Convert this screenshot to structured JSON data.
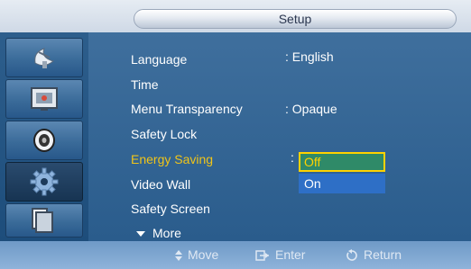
{
  "header": {
    "title": "Setup"
  },
  "sidebar": {
    "items": [
      {
        "icon": "satellite-dish-icon"
      },
      {
        "icon": "picture-icon"
      },
      {
        "icon": "speaker-icon"
      },
      {
        "icon": "gear-icon",
        "active": true
      },
      {
        "icon": "multi-screen-icon"
      }
    ]
  },
  "menu": {
    "items": [
      {
        "label": "Language",
        "value": ": English"
      },
      {
        "label": "Time",
        "value": ""
      },
      {
        "label": "Menu Transparency",
        "value": ": Opaque"
      },
      {
        "label": "Safety Lock",
        "value": ""
      },
      {
        "label": "Energy Saving",
        "value": ":",
        "highlighted": true
      },
      {
        "label": "Video Wall",
        "value": ""
      },
      {
        "label": "Safety Screen",
        "value": ""
      }
    ],
    "more_label": "More"
  },
  "dropdown": {
    "options": [
      "Off",
      "On"
    ],
    "selected": "Off"
  },
  "help_bar": {
    "move": "Move",
    "enter": "Enter",
    "return": "Return"
  },
  "colors": {
    "highlight": "#f0c419",
    "panel": "#2a5c8c",
    "selected_option_bg": "#2f8a68",
    "option_bg": "#2e6fc6"
  }
}
